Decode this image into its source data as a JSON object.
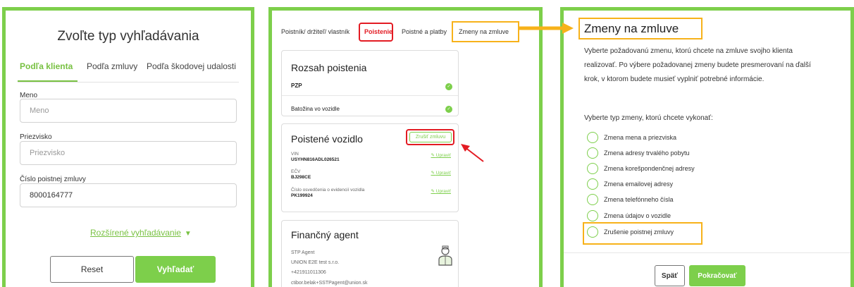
{
  "colors": {
    "accent_green": "#7dcf4b",
    "highlight_red": "#e31b23",
    "highlight_orange": "#f7b21a"
  },
  "search": {
    "title": "Zvoľte typ vyhľadávania",
    "tabs": [
      {
        "label": "Podľa klienta",
        "active": true
      },
      {
        "label": "Podľa zmluvy",
        "active": false
      },
      {
        "label": "Podľa škodovej udalosti",
        "active": false
      }
    ],
    "fields": [
      {
        "label": "Meno",
        "value": "",
        "placeholder": "Meno"
      },
      {
        "label": "Priezvisko",
        "value": "",
        "placeholder": "Priezvisko"
      },
      {
        "label": "Číslo poistnej zmluvy",
        "value": "8000164777",
        "placeholder": ""
      }
    ],
    "advanced_link": "Rozšírené vyhľadávanie",
    "reset_label": "Reset",
    "search_label": "Vyhľadať"
  },
  "policy": {
    "tabs": [
      "Poistník/ držiteľ/ vlastník",
      "Poistenie",
      "Poistné a platby",
      "Zmeny na zmluve"
    ],
    "active_tab": "Poistenie",
    "scope": {
      "title": "Rozsah poistenia",
      "items": [
        "PZP",
        "Batožina vo vozidle"
      ]
    },
    "vehicle": {
      "title": "Poistené vozidlo",
      "action_label": "Zrušiť zmluvu",
      "rows": [
        {
          "label": "VIN",
          "value": "USYHN816ADL026521",
          "edit": "Upraviť"
        },
        {
          "label": "EČV",
          "value": "BJ298CE",
          "edit": "Upraviť"
        },
        {
          "label": "Číslo osvedčenia o evidencií vozidla",
          "value": "PK199924",
          "edit": "Upraviť"
        }
      ]
    },
    "agent": {
      "title": "Finančný agent",
      "lines": [
        "STP Agent",
        "UNION E2E test s.r.o.",
        "+421911011306",
        "ctibor.belak+SSTPagent@union.sk"
      ]
    }
  },
  "changes": {
    "title": "Zmeny na zmluve",
    "description": "Vyberte požadovanú zmenu, ktorú chcete na zmluve svojho klienta realizovať. Po výbere požadovanej zmeny budete presmerovaní na ďalší krok, v ktorom budete musieť vyplniť potrebné informácie.",
    "subtitle": "Vyberte typ zmeny, ktorú chcete vykonať:",
    "options": [
      "Zmena mena a priezviska",
      "Zmena adresy trvalého pobytu",
      "Zmena korešpondenčnej adresy",
      "Zmena emailovej adresy",
      "Zmena telefónneho čísla",
      "Zmena údajov o vozidle",
      "Zrušenie poistnej zmluvy"
    ],
    "back_label": "Späť",
    "next_label": "Pokračovať"
  }
}
